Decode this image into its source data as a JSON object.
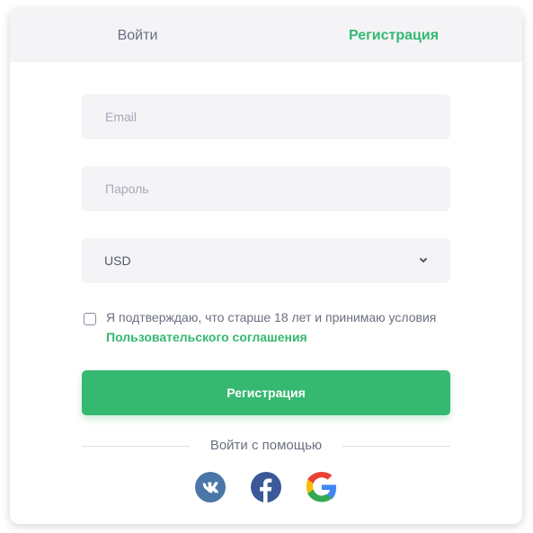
{
  "tabs": {
    "login": "Войти",
    "register": "Регистрация"
  },
  "form": {
    "email_placeholder": "Email",
    "password_placeholder": "Пароль",
    "currency_value": "USD",
    "agree_text": "Я подтверждаю, что старше 18 лет и принимаю условия ",
    "agree_link": "Пользовательского соглашения",
    "agree_checked": false,
    "submit_label": "Регистрация"
  },
  "social": {
    "divider_text": "Войти с помощью",
    "providers": [
      "vk-icon",
      "facebook-icon",
      "google-icon"
    ]
  },
  "colors": {
    "accent": "#34b870",
    "tab_bg": "#f4f4f7",
    "field_bg": "#f4f4f7",
    "vk": "#4a76a8",
    "facebook": "#3b5998"
  }
}
